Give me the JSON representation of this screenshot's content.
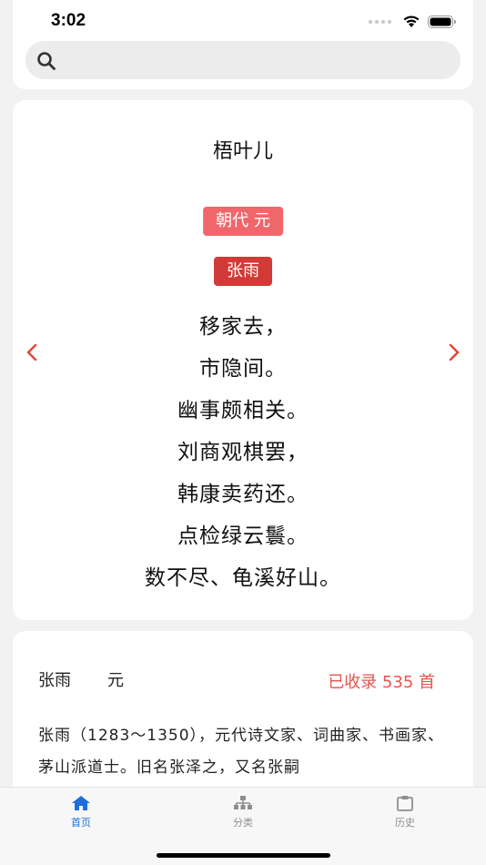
{
  "status_bar": {
    "time": "3:02"
  },
  "search": {
    "placeholder": ""
  },
  "poem": {
    "title": "梧叶儿",
    "dynasty_tag": "朝代 元",
    "author_tag": "张雨",
    "lines": [
      "移家去，",
      "市隐间。",
      "幽事颇相关。",
      "刘商观棋罢，",
      "韩康卖药还。",
      "点检绿云鬟。",
      "数不尽、龟溪好山。"
    ]
  },
  "author": {
    "name": "张雨",
    "dynasty": "元",
    "collected": "已收录 535 首",
    "bio": "张雨（1283～1350），元代诗文家、词曲家、书画家、茅山派道士。旧名张泽之，又名张嗣"
  },
  "tabs": [
    {
      "label": "首页",
      "icon": "home-icon",
      "active": true
    },
    {
      "label": "分类",
      "icon": "category-icon",
      "active": false
    },
    {
      "label": "历史",
      "icon": "history-icon",
      "active": false
    }
  ],
  "colors": {
    "accent_red": "#d13a36",
    "tag_pink": "#f0676b",
    "arrow_red": "#e8432f",
    "tab_active": "#1e6fd9"
  }
}
